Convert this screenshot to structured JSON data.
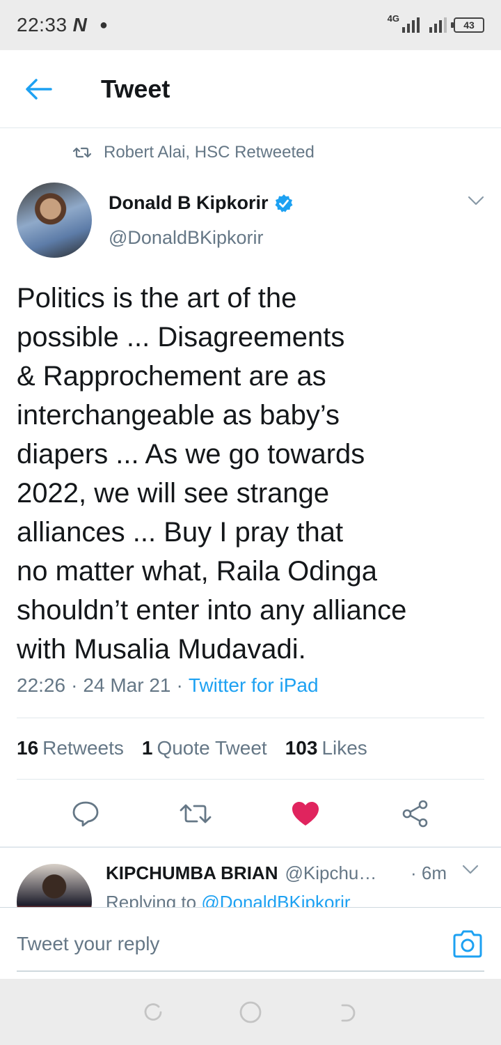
{
  "status_bar": {
    "time": "22:33",
    "carrier_logo": "N",
    "network": "4G",
    "battery": "43"
  },
  "header": {
    "title": "Tweet",
    "back_icon": "arrow-left-icon"
  },
  "retweet": {
    "label": "Robert Alai, HSC Retweeted"
  },
  "tweet": {
    "author_name": "Donald B Kipkorir",
    "author_handle": "@DonaldBKipkorir",
    "verified": true,
    "text": "Politics is the art of the\npossible ... Disagreements\n& Rapprochement are as\ninterchangeable as baby’s\ndiapers ... As we go towards\n2022, we will see strange\nalliances ... Buy I pray that\nno matter what, Raila Odinga\nshouldn’t enter into any alliance\nwith Musalia Mudavadi.",
    "time": "22:26",
    "sep": "·",
    "date": "24 Mar 21",
    "source": "Twitter for iPad"
  },
  "stats": {
    "retweets_count": "16",
    "retweets_label": "Retweets",
    "quotes_count": "1",
    "quotes_label": "Quote Tweet",
    "likes_count": "103",
    "likes_label": "Likes"
  },
  "actions": [
    "reply-icon",
    "retweet-icon",
    "heart-icon",
    "share-icon"
  ],
  "reply_preview": {
    "name": "KIPCHUMBA BRIAN",
    "handle": "@Kipchu…",
    "time": "· 6m",
    "replying_prefix": "Replying to",
    "replying_to": "@DonaldBKipkorir"
  },
  "compose": {
    "placeholder": "Tweet your reply"
  },
  "colors": {
    "accent": "#1da1f2",
    "like": "#e0245e",
    "muted": "#657786",
    "text": "#14171a"
  }
}
